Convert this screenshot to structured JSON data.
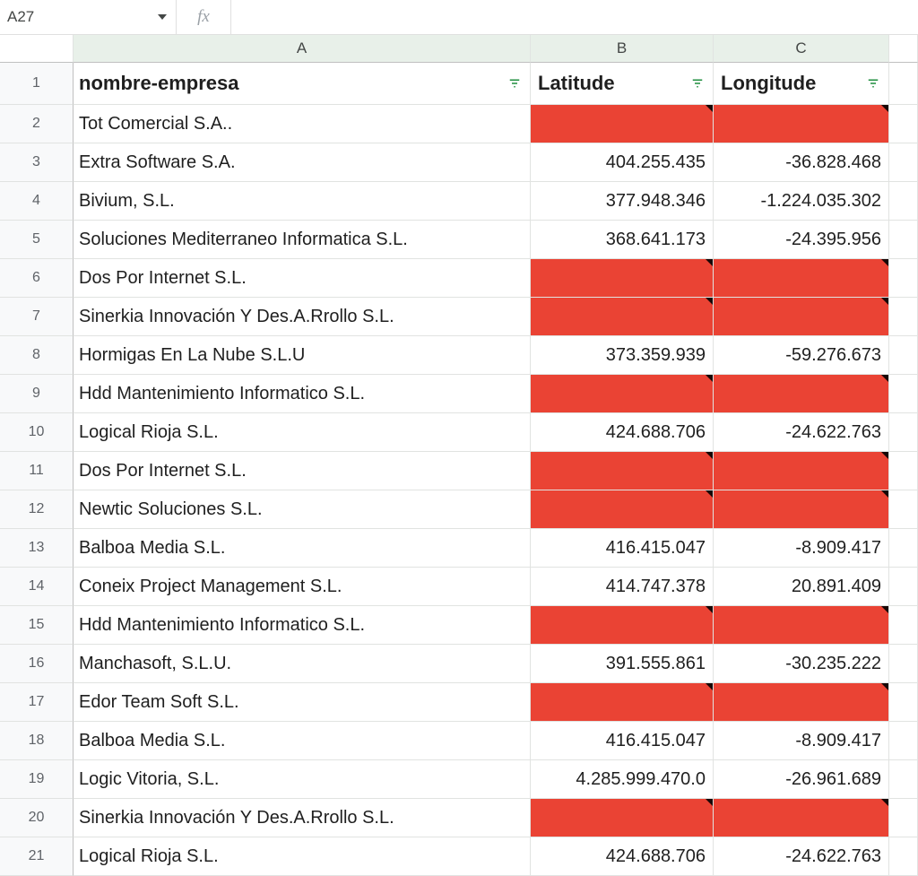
{
  "formula_bar": {
    "cell_ref": "A27",
    "fx_label": "fx",
    "formula": ""
  },
  "columns": {
    "A": "A",
    "B": "B",
    "C": "C"
  },
  "headers": {
    "A": "nombre-empresa",
    "B": "Latitude",
    "C": "Longitude"
  },
  "rows": [
    {
      "n": "1"
    },
    {
      "n": "2",
      "a": "Tot Comercial S.A..",
      "b": "",
      "c": "",
      "red": true
    },
    {
      "n": "3",
      "a": "Extra Software S.A.",
      "b": "404.255.435",
      "c": "-36.828.468",
      "red": false
    },
    {
      "n": "4",
      "a": "Bivium, S.L.",
      "b": "377.948.346",
      "c": "-1.224.035.302",
      "red": false
    },
    {
      "n": "5",
      "a": "Soluciones Mediterraneo Informatica  S.L.",
      "b": "368.641.173",
      "c": "-24.395.956",
      "red": false
    },
    {
      "n": "6",
      "a": "Dos Por Internet  S.L.",
      "b": "",
      "c": "",
      "red": true
    },
    {
      "n": "7",
      "a": "Sinerkia Innovación Y Des.A.Rrollo  S.L.",
      "b": "",
      "c": "",
      "red": true
    },
    {
      "n": "8",
      "a": "Hormigas En La Nube  S.L.U",
      "b": "373.359.939",
      "c": "-59.276.673",
      "red": false
    },
    {
      "n": "9",
      "a": "Hdd Mantenimiento Informatico  S.L.",
      "b": "",
      "c": "",
      "red": true
    },
    {
      "n": "10",
      "a": "Logical Rioja  S.L.",
      "b": "424.688.706",
      "c": "-24.622.763",
      "red": false
    },
    {
      "n": "11",
      "a": "Dos Por Internet  S.L.",
      "b": "",
      "c": "",
      "red": true
    },
    {
      "n": "12",
      "a": "Newtic Soluciones  S.L.",
      "b": "",
      "c": "",
      "red": true
    },
    {
      "n": "13",
      "a": "Balboa Media  S.L.",
      "b": "416.415.047",
      "c": "-8.909.417",
      "red": false
    },
    {
      "n": "14",
      "a": "Coneix Project Management  S.L.",
      "b": "414.747.378",
      "c": "20.891.409",
      "red": false
    },
    {
      "n": "15",
      "a": "Hdd Mantenimiento Informatico  S.L.",
      "b": "",
      "c": "",
      "red": true
    },
    {
      "n": "16",
      "a": "Manchasoft, S.L.U.",
      "b": "391.555.861",
      "c": "-30.235.222",
      "red": false
    },
    {
      "n": "17",
      "a": "Edor Team Soft  S.L.",
      "b": "",
      "c": "",
      "red": true
    },
    {
      "n": "18",
      "a": "Balboa Media  S.L.",
      "b": "416.415.047",
      "c": "-8.909.417",
      "red": false
    },
    {
      "n": "19",
      "a": "Logic Vitoria, S.L.",
      "b": "4.285.999.470.0",
      "c": "-26.961.689",
      "red": false
    },
    {
      "n": "20",
      "a": "Sinerkia Innovación Y Des.A.Rrollo  S.L.",
      "b": "",
      "c": "",
      "red": true
    },
    {
      "n": "21",
      "a": "Logical Rioja  S.L.",
      "b": "424.688.706",
      "c": "-24.622.763",
      "red": false
    }
  ]
}
